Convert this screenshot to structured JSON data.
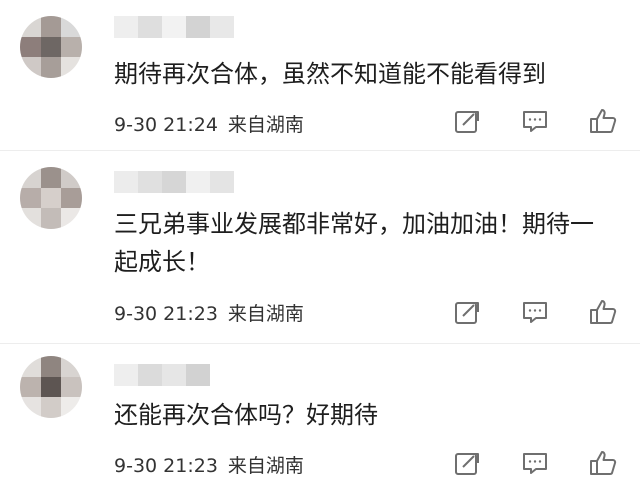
{
  "comments": [
    {
      "text": "期待再次合体，虽然不知道能不能看得到",
      "time": "9-30 21:24",
      "location": "来自湖南"
    },
    {
      "text": "三兄弟事业发展都非常好，加油加油！期待一起成长！",
      "time": "9-30 21:23",
      "location": "来自湖南"
    },
    {
      "text": "还能再次合体吗？好期待",
      "time": "9-30 21:23",
      "location": "来自湖南"
    }
  ],
  "icons": [
    "repost-icon",
    "comment-icon",
    "like-icon"
  ],
  "colors": {
    "icon_stroke": "#6f6f6f",
    "text": "#1e1e1e",
    "meta": "#333333",
    "divider": "#ededed"
  }
}
